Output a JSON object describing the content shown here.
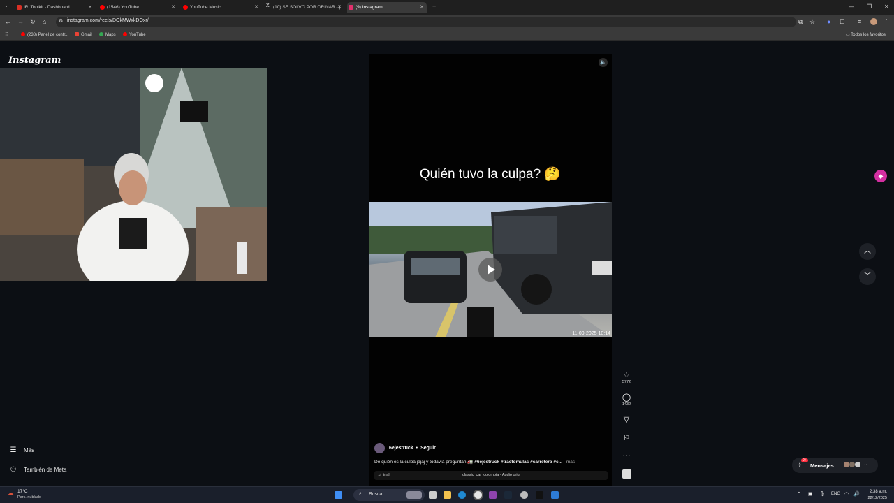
{
  "browser": {
    "tabs": [
      {
        "title": "IRLToolkit - Dashboard",
        "color": "#d93025"
      },
      {
        "title": "(1546) YouTube",
        "color": "#ff0000"
      },
      {
        "title": "YouTube Music",
        "color": "#ff0000"
      },
      {
        "title": "(10) SE SOLVO POR ORINAR - |",
        "color": "#ffffff"
      },
      {
        "title": "(9) Instagram",
        "color": "#e1306c"
      }
    ],
    "new_tab_label": "+",
    "url": "instagram.com/reels/DOkMWxkDOxr/",
    "bookmarks": [
      "(238) Panel de contr...",
      "Gmail",
      "Maps",
      "YouTube"
    ],
    "all_favorites_label": "Todos los favoritos"
  },
  "instagram": {
    "logo": "Instagram",
    "sidebar": {
      "more_label": "Más",
      "meta_label": "También de Meta"
    },
    "reel": {
      "headline": "Quién tuvo la culpa? 🤔",
      "timestamp": "11-09-2025 10:14",
      "truck_text": "VE",
      "likes": "5772",
      "comments": "1432",
      "username": "6ejestruck",
      "follow_label": "Seguir",
      "description_plain": "De quién es la culpa jajaj y todavía preguntan 🚛 ",
      "description_tags": "#6ejestruck #tractomulas #carretera #c...",
      "more_label": "más",
      "audio_left": "inal",
      "audio_right": "classic_car_colombia · Audio orig"
    },
    "messages": {
      "label": "Mensajes",
      "badge": "9+"
    }
  },
  "taskbar": {
    "weather_temp": "17°C",
    "weather_desc": "Parc. nublado",
    "search_label": "Buscar",
    "lang": "ENG",
    "time": "2:38 a.m.",
    "date": "22/12/2025"
  }
}
